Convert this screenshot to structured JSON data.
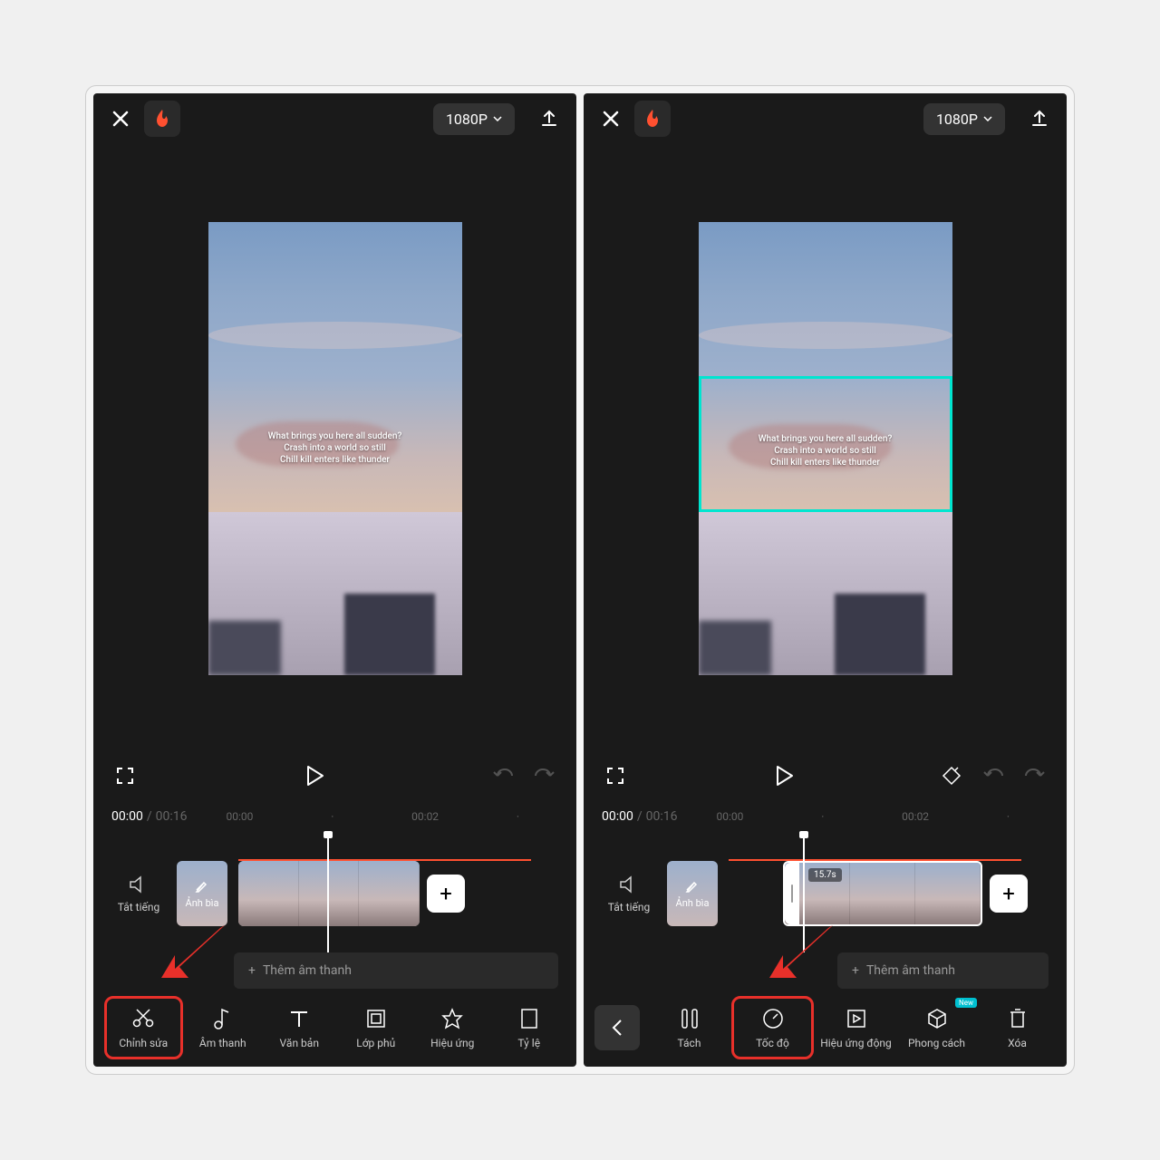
{
  "topbar": {
    "resolution": "1080P"
  },
  "preview": {
    "text_line1": "What brings you here all sudden?",
    "text_line2": "Crash into a world so still",
    "text_line3": "Chill kill enters like thunder"
  },
  "timeline": {
    "current": "00:00",
    "total": "00:16",
    "marks": [
      "00:00",
      "00:02"
    ],
    "mute_label": "Tắt tiếng",
    "cover_label": "Ảnh bìa",
    "add_audio": "Thêm âm thanh",
    "clip_duration": "15.7s"
  },
  "left_toolbar": [
    {
      "label": "Chỉnh sửa"
    },
    {
      "label": "Âm thanh"
    },
    {
      "label": "Văn bản"
    },
    {
      "label": "Lớp phủ"
    },
    {
      "label": "Hiệu ứng"
    },
    {
      "label": "Tỷ lệ"
    }
  ],
  "right_toolbar": [
    {
      "label": "Tách"
    },
    {
      "label": "Tốc độ"
    },
    {
      "label": "Hiệu ứng động"
    },
    {
      "label": "Phong cách"
    },
    {
      "label": "Xóa"
    }
  ],
  "new_badge": "New"
}
